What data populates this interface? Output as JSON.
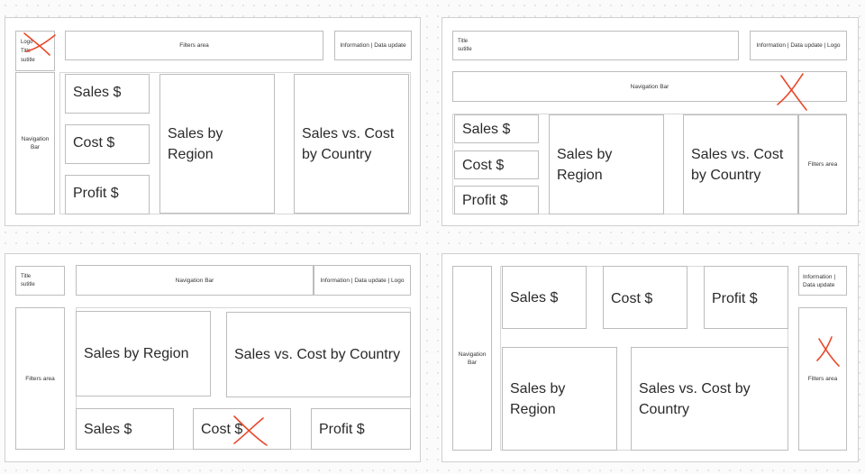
{
  "mockups": [
    {
      "logo_title_subtitle": "Logo\nTitle\nsutitle",
      "filters": "Filters area",
      "info": "Information | Data update",
      "nav": "Navigation\nBar",
      "sales": "Sales $",
      "cost": "Cost $",
      "profit": "Profit $",
      "region": "Sales by\nRegion",
      "country": "Sales vs. Cost\nby Country"
    },
    {
      "title_subtitle": "Title\nsutitle",
      "info": "Information | Data update | Logo",
      "nav": "Navigation Bar",
      "sales": "Sales $",
      "cost": "Cost $",
      "profit": "Profit $",
      "region": "Sales by\nRegion",
      "country": "Sales vs. Cost\nby Country",
      "filters": "Filters area"
    },
    {
      "title_subtitle": "Title\nsutitle",
      "nav": "Navigation Bar",
      "info": "Information | Data update | Logo",
      "filters": "Filters area",
      "region": "Sales by Region",
      "country": "Sales vs. Cost by Country",
      "sales": "Sales $",
      "cost": "Cost $",
      "profit": "Profit $"
    },
    {
      "nav": "Navigation\nBar",
      "sales": "Sales $",
      "cost": "Cost $",
      "profit": "Profit $",
      "info": "Information |\nData update",
      "region": "Sales by\nRegion",
      "country": "Sales vs. Cost by\nCountry",
      "filters": "Filters area"
    }
  ],
  "annotations": {
    "cross_color": "#e8492b",
    "crossed_out": [
      "mockup1-logo",
      "mockup2-navigation-bar",
      "mockup3-cost",
      "mockup4-filters-area"
    ]
  }
}
